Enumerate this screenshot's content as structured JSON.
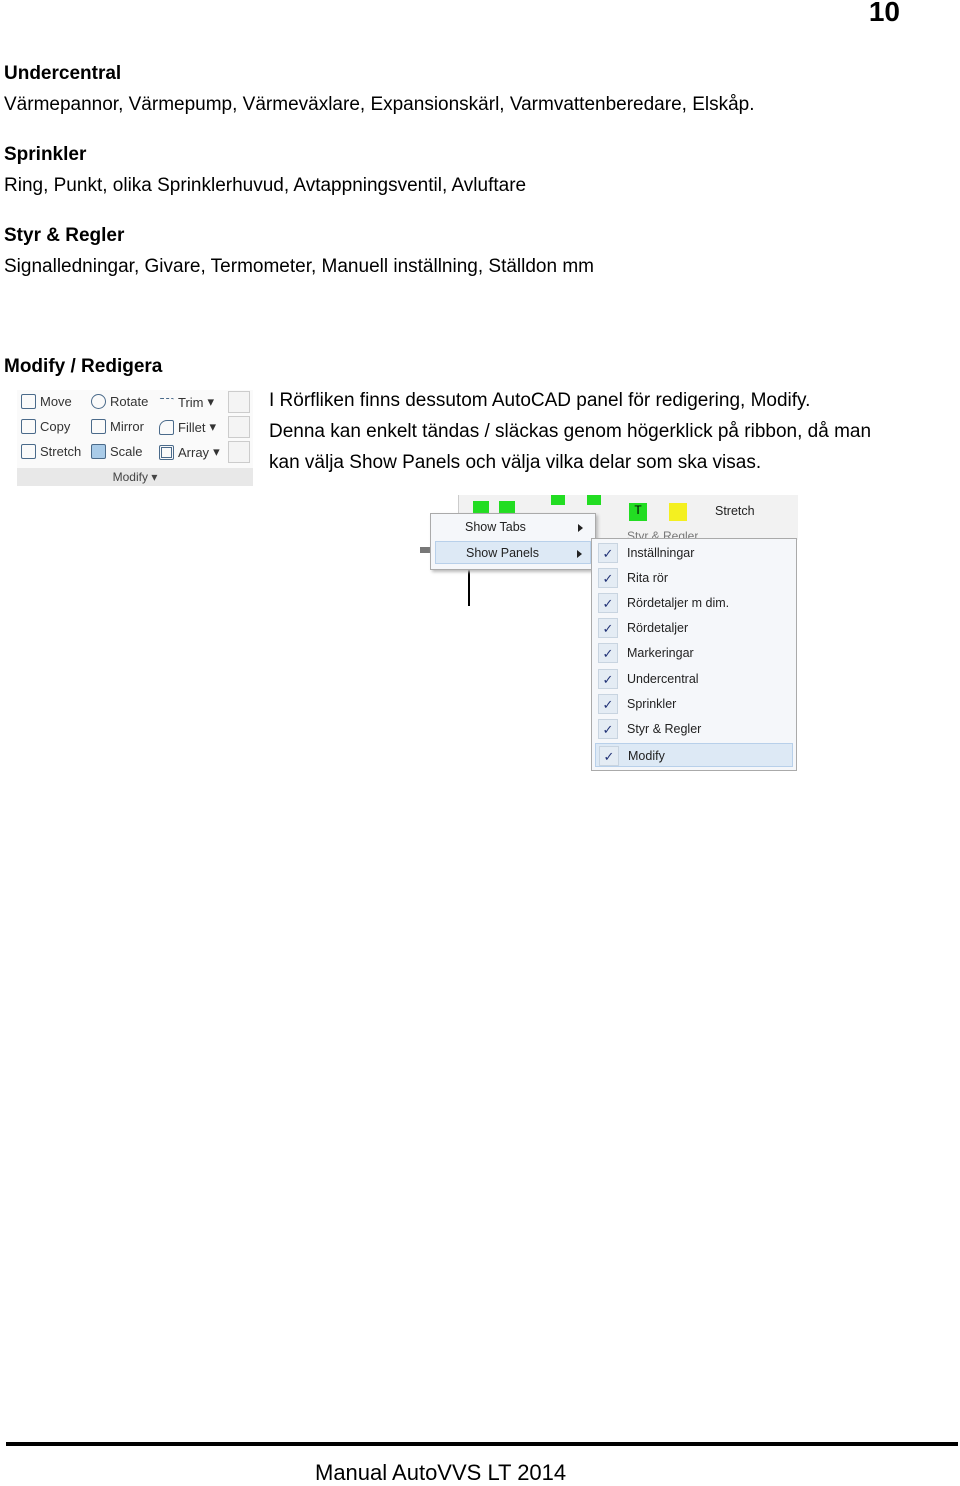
{
  "page_number": "10",
  "sections": [
    {
      "heading": "Undercentral",
      "text": "Värmepannor, Värmepump, Värmeväxlare, Expansionskärl, Varmvattenberedare, Elskåp."
    },
    {
      "heading": "Sprinkler",
      "text": "Ring, Punkt, olika Sprinklerhuvud, Avtappningsventil, Avluftare"
    },
    {
      "heading": "Styr & Regler",
      "text": "Signalledningar, Givare, Termometer, Manuell inställning, Ställdon mm"
    }
  ],
  "modify": {
    "heading": "Modify / Redigera",
    "lines": [
      "I Rörfliken finns dessutom AutoCAD panel för redigering, Modify.",
      "Denna kan enkelt tändas / släckas genom högerklick på ribbon, då man",
      "kan välja Show Panels och välja vilka delar som ska visas."
    ],
    "panel": {
      "buttons": [
        "Move",
        "Rotate",
        "Trim",
        "Copy",
        "Mirror",
        "Fillet",
        "Stretch",
        "Scale",
        "Array"
      ],
      "title": "Modify"
    }
  },
  "context_menu": {
    "ribbon_label": "Styr & Regler",
    "ribbon_stretch": "Stretch",
    "items": [
      "Show Tabs",
      "Show Panels"
    ],
    "panels": [
      "Inställningar",
      "Rita rör",
      "Rördetaljer m dim.",
      "Rördetaljer",
      "Markeringar",
      "Undercentral",
      "Sprinkler",
      "Styr & Regler",
      "Modify"
    ]
  },
  "footer": "Manual AutoVVS LT 2014"
}
